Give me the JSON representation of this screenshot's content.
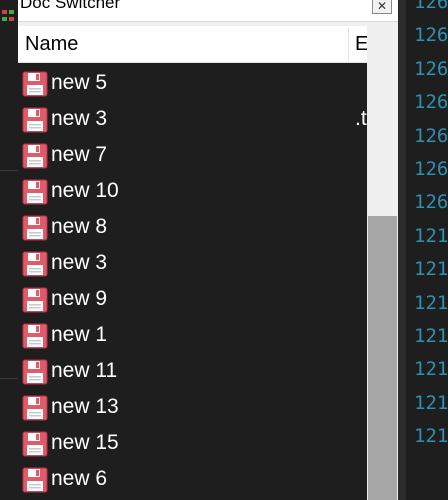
{
  "panel": {
    "title": "Doc Switcher",
    "close_glyph": "✕",
    "columns": {
      "name": "Name",
      "ext": "E"
    }
  },
  "documents": [
    {
      "name": "new 5",
      "ext": ""
    },
    {
      "name": "new 3",
      "ext": ".t"
    },
    {
      "name": "new 7",
      "ext": ""
    },
    {
      "name": "new 10",
      "ext": ""
    },
    {
      "name": "new 8",
      "ext": ""
    },
    {
      "name": "new 3",
      "ext": ""
    },
    {
      "name": "new 9",
      "ext": ""
    },
    {
      "name": "new 1",
      "ext": ""
    },
    {
      "name": "new 11",
      "ext": ""
    },
    {
      "name": "new 13",
      "ext": ""
    },
    {
      "name": "new 15",
      "ext": ""
    },
    {
      "name": "new 6",
      "ext": ""
    }
  ],
  "document_icon": "save-disk-icon",
  "line_numbers": [
    "126",
    "126",
    "126",
    "126",
    "126",
    "126",
    "126",
    "121",
    "121",
    "121",
    "121",
    "121",
    "121",
    "121"
  ],
  "colors": {
    "list_bg": "#1e1e1e",
    "icon": "#e05a6a",
    "line_number": "#2b91af"
  }
}
